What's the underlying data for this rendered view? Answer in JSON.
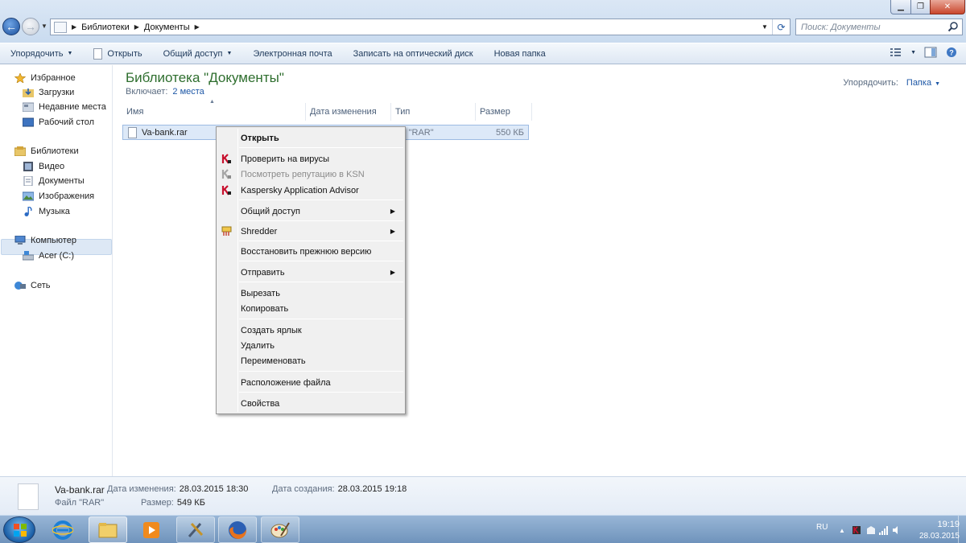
{
  "address": {
    "crumbs": [
      "Библиотеки",
      "Документы"
    ]
  },
  "search": {
    "placeholder": "Поиск: Документы"
  },
  "commandbar": {
    "organize": "Упорядочить",
    "open": "Открыть",
    "share": "Общий доступ",
    "email": "Электронная почта",
    "burn": "Записать на оптический диск",
    "new_folder": "Новая папка"
  },
  "nav": {
    "favorites": "Избранное",
    "downloads": "Загрузки",
    "recent": "Недавние места",
    "desktop": "Рабочий стол",
    "libraries": "Библиотеки",
    "video": "Видео",
    "documents": "Документы",
    "images": "Изображения",
    "music": "Музыка",
    "computer": "Компьютер",
    "drive": "Acer (C:)",
    "network": "Сеть"
  },
  "content": {
    "title": "Библиотека \"Документы\"",
    "includes_label": "Включает:",
    "includes_link": "2 места",
    "sort_label": "Упорядочить:",
    "sort_value": "Папка",
    "columns": [
      "Имя",
      "Дата изменения",
      "Тип",
      "Размер"
    ],
    "file": {
      "name": "Va-bank.rar",
      "type": "йл \"RAR\"",
      "size": "550 КБ"
    }
  },
  "context_menu": {
    "open": "Открыть",
    "scan": "Проверить на вирусы",
    "ksn": "Посмотреть репутацию в KSN",
    "kaa": "Kaspersky Application Advisor",
    "share": "Общий доступ",
    "shredder": "Shredder",
    "restore": "Восстановить прежнюю версию",
    "send_to": "Отправить",
    "cut": "Вырезать",
    "copy": "Копировать",
    "shortcut": "Создать ярлык",
    "delete": "Удалить",
    "rename": "Переименовать",
    "location": "Расположение файла",
    "properties": "Свойства"
  },
  "details": {
    "name": "Va-bank.rar",
    "type": "Файл \"RAR\"",
    "modified_label": "Дата изменения:",
    "modified_value": "28.03.2015 18:30",
    "created_label": "Дата создания:",
    "created_value": "28.03.2015 19:18",
    "size_label": "Размер:",
    "size_value": "549 КБ"
  },
  "taskbar": {
    "lang": "RU",
    "time": "19:19",
    "date": "28.03.2015"
  },
  "colors": {
    "accent_blue": "#1d57a6",
    "title_green": "#2e6e2e",
    "selection": "#dde9f8",
    "kaspersky_red": "#c8102e"
  }
}
